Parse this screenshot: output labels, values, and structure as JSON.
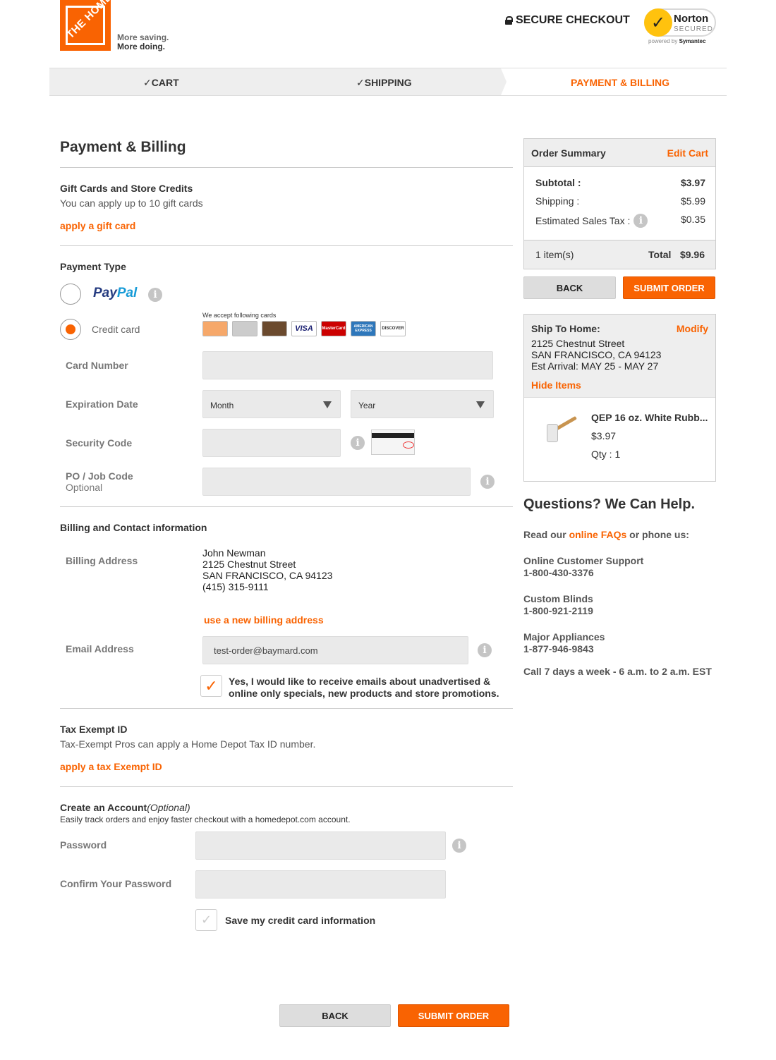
{
  "brand": {
    "logo_text": "THE HOME DEPOT",
    "tagline_1": "More saving.",
    "tagline_2": "More doing."
  },
  "header": {
    "secure_checkout": "SECURE CHECKOUT",
    "norton_name": "Norton",
    "norton_secured": "SECURED",
    "norton_powered_prefix": "powered by",
    "norton_powered_brand": "Symantec"
  },
  "steps": [
    {
      "label": "CART",
      "done": true
    },
    {
      "label": "SHIPPING",
      "done": true
    },
    {
      "label": "PAYMENT & BILLING",
      "active": true
    }
  ],
  "page_title": "Payment & Billing",
  "gift": {
    "title": "Gift Cards and Store Credits",
    "subtitle": "You can apply up to 10 gift cards",
    "link": "apply a gift card"
  },
  "payment": {
    "title": "Payment Type",
    "paypal_a": "Pay",
    "paypal_b": "Pal",
    "credit_label": "Credit card",
    "cards_label": "We accept following cards",
    "cards": [
      "",
      "",
      "",
      "VISA",
      "MasterCard",
      "AMERICAN EXPRESS",
      "DISCOVER"
    ],
    "card_number_label": "Card Number",
    "expiration_label": "Expiration Date",
    "month_placeholder": "Month",
    "year_placeholder": "Year",
    "security_label": "Security Code",
    "po_label": "PO / Job Code",
    "po_optional": "Optional"
  },
  "billing": {
    "title": "Billing and Contact information",
    "address_label": "Billing Address",
    "name": "John Newman",
    "street": "2125 Chestnut Street",
    "city": "SAN FRANCISCO, CA 94123",
    "phone": "(415) 315-9111",
    "new_address_link": "use a new billing address",
    "email_label": "Email Address",
    "email_value": "test-order@baymard.com",
    "consent_text": "Yes, I would like to receive emails about unadvertised & online only specials, new products and store promotions."
  },
  "tax": {
    "title": "Tax Exempt ID",
    "subtitle": "Tax-Exempt Pros can apply a Home Depot Tax ID number.",
    "link": "apply a tax Exempt ID"
  },
  "account": {
    "title": "Create an Account",
    "optional": "(Optional)",
    "subtitle": "Easily track orders and enjoy faster checkout with a homedepot.com account.",
    "password_label": "Password",
    "confirm_label": "Confirm Your Password",
    "save_card_label": "Save my credit card information"
  },
  "buttons": {
    "back": "BACK",
    "submit": "SUBMIT ORDER"
  },
  "summary": {
    "title": "Order Summary",
    "edit": "Edit Cart",
    "subtotal_label": "Subtotal :",
    "subtotal": "$3.97",
    "shipping_label": "Shipping :",
    "shipping": "$5.99",
    "tax_label": "Estimated Sales Tax :",
    "tax": "$0.35",
    "items": "1 item(s)",
    "total_label": "Total",
    "total": "$9.96"
  },
  "ship_to": {
    "title": "Ship To Home:",
    "modify": "Modify",
    "street": "2125 Chestnut Street",
    "city": "SAN FRANCISCO, CA 94123",
    "arrival": "Est Arrival: MAY 25 - MAY 27",
    "hide_items": "Hide Items",
    "product_name": "QEP 16 oz. White Rubb...",
    "product_price": "$3.97",
    "product_qty": "Qty : 1"
  },
  "help": {
    "title": "Questions? We Can Help.",
    "read_prefix": "Read our",
    "faq_link": "online FAQs",
    "read_suffix": "or phone us:",
    "lines": [
      {
        "label": "Online Customer Support",
        "phone": "1-800-430-3376"
      },
      {
        "label": "Custom Blinds",
        "phone": "1-800-921-2119"
      },
      {
        "label": "Major Appliances",
        "phone": "1-877-946-9843"
      }
    ],
    "hours": "Call 7 days a week - 6 a.m. to 2 a.m. EST"
  },
  "colors": {
    "brand_orange": "#f96302",
    "panel_gray": "#eeeeee",
    "input_gray": "#eaeaea"
  }
}
